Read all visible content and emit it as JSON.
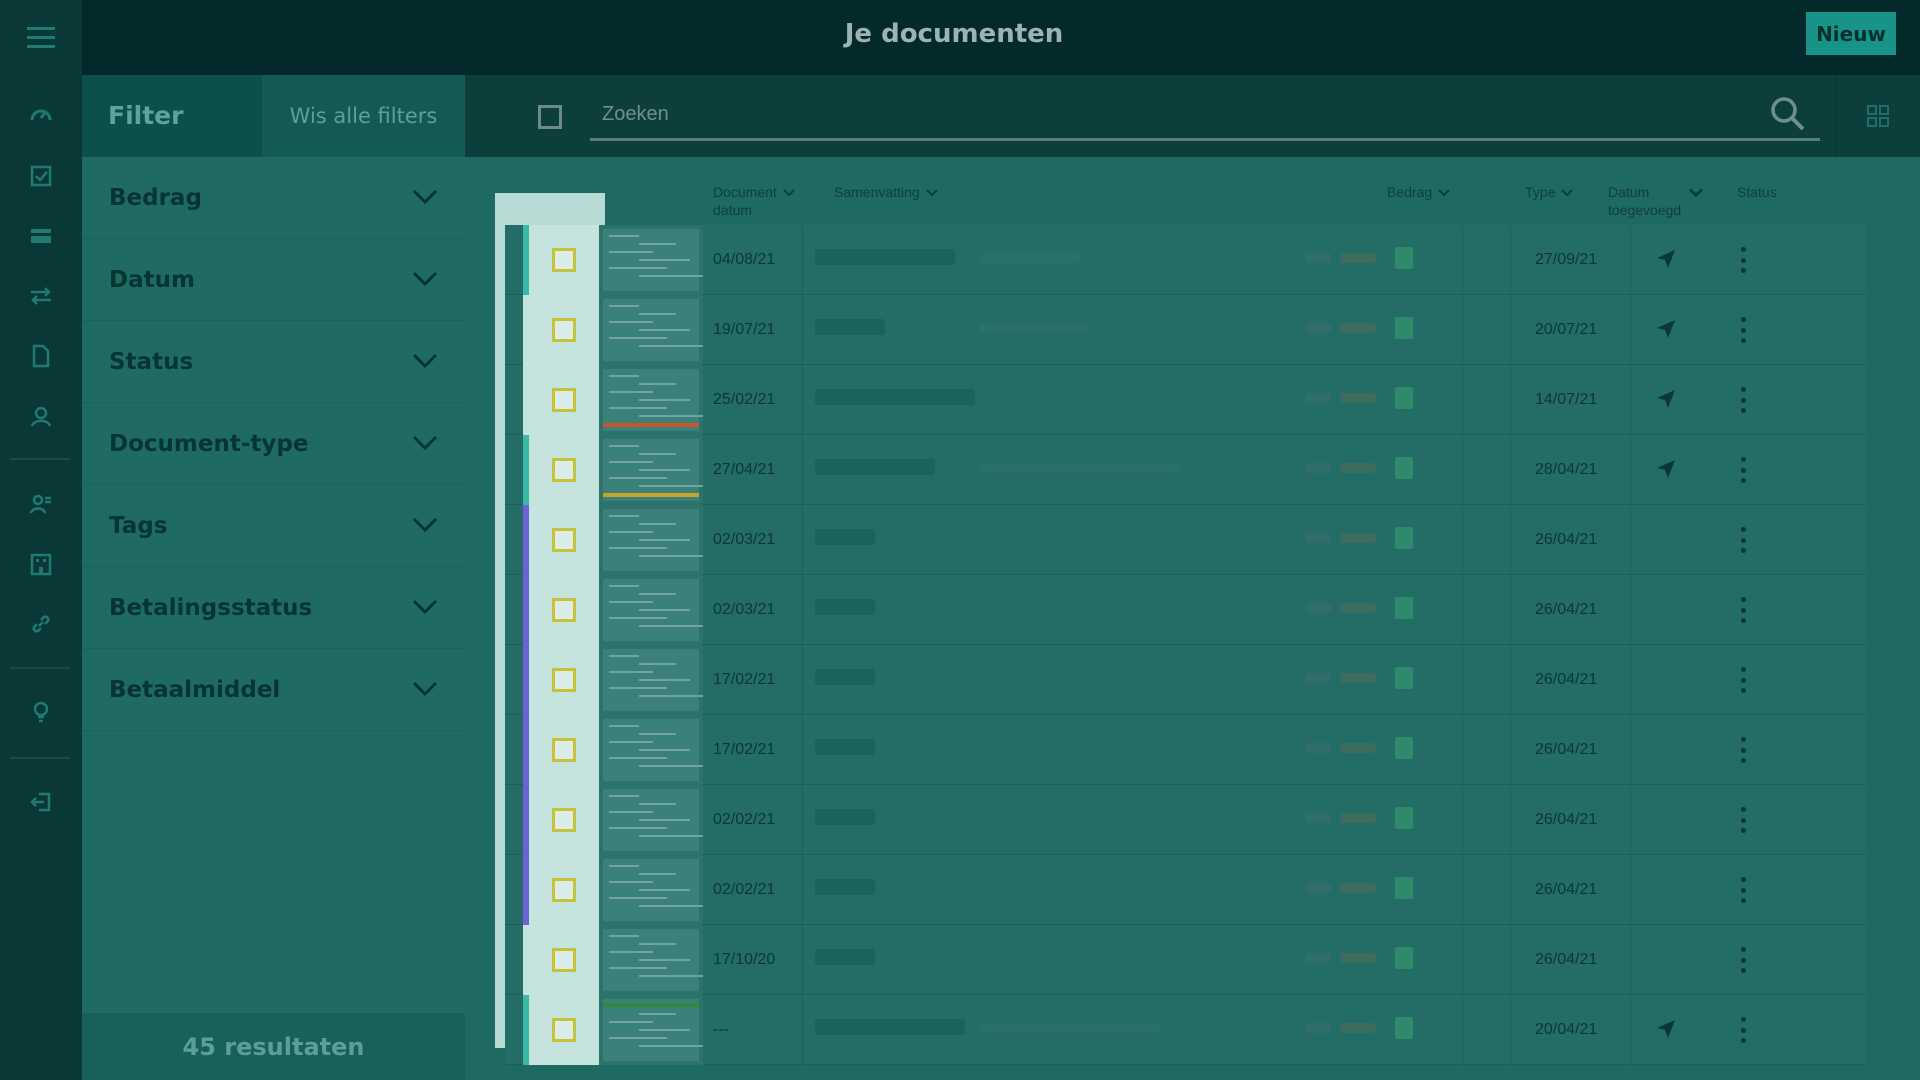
{
  "header": {
    "title": "Je documenten",
    "new_label": "Nieuw"
  },
  "rail": {
    "icons": [
      "menu-icon",
      "dashboard-icon",
      "checklist-icon",
      "card-icon",
      "transfer-icon",
      "document-icon",
      "contacts-icon",
      "user-list-icon",
      "building-icon",
      "link-icon",
      "lightbulb-icon",
      "logout-icon"
    ]
  },
  "filters": {
    "title": "Filter",
    "clear_label": "Wis alle filters",
    "items": [
      {
        "label": "Bedrag"
      },
      {
        "label": "Datum"
      },
      {
        "label": "Status"
      },
      {
        "label": "Document-type"
      },
      {
        "label": "Tags"
      },
      {
        "label": "Betalingsstatus"
      },
      {
        "label": "Betaalmiddel"
      }
    ],
    "results_label": "45 resultaten"
  },
  "search": {
    "placeholder": "Zoeken"
  },
  "table": {
    "columns": {
      "doc_date_1": "Document",
      "doc_date_2": "datum",
      "summary": "Samenvatting",
      "amount": "Bedrag",
      "type": "Type",
      "added_1": "Datum",
      "added_2": "toegevoegd",
      "status": "Status"
    },
    "rows": [
      {
        "doc_date": "04/08/21",
        "date_added": "27/09/21",
        "sent": true,
        "tab": "#3bb9a7"
      },
      {
        "doc_date": "19/07/21",
        "date_added": "20/07/21",
        "sent": true,
        "tab": "#c6e4de"
      },
      {
        "doc_date": "25/02/21",
        "date_added": "14/07/21",
        "sent": true,
        "tab": "#c6e4de"
      },
      {
        "doc_date": "27/04/21",
        "date_added": "28/04/21",
        "sent": true,
        "tab": "#3bb9a7"
      },
      {
        "doc_date": "02/03/21",
        "date_added": "26/04/21",
        "sent": false,
        "tab": "#6c62d6"
      },
      {
        "doc_date": "02/03/21",
        "date_added": "26/04/21",
        "sent": false,
        "tab": "#6c62d6"
      },
      {
        "doc_date": "17/02/21",
        "date_added": "26/04/21",
        "sent": false,
        "tab": "#6c62d6"
      },
      {
        "doc_date": "17/02/21",
        "date_added": "26/04/21",
        "sent": false,
        "tab": "#6c62d6"
      },
      {
        "doc_date": "02/02/21",
        "date_added": "26/04/21",
        "sent": false,
        "tab": "#6c62d6"
      },
      {
        "doc_date": "02/02/21",
        "date_added": "26/04/21",
        "sent": false,
        "tab": "#6c62d6"
      },
      {
        "doc_date": "17/10/20",
        "date_added": "26/04/21",
        "sent": false,
        "tab": "#c6e4de"
      },
      {
        "doc_date": "---",
        "date_added": "20/04/21",
        "sent": true,
        "tab": "#3bb9a7"
      }
    ]
  }
}
